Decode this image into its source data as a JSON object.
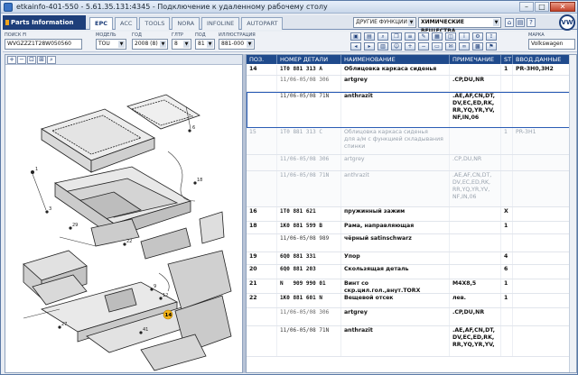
{
  "window": {
    "title": "etkainfo-401-550 - 5.61.35.131:4345 - Подключение к удаленному рабочему столу"
  },
  "topbar": {
    "brand": "Parts Information",
    "tabs": [
      {
        "label": "EPC",
        "active": true
      },
      {
        "label": "ACC",
        "active": false
      },
      {
        "label": "TOOLS",
        "active": false
      },
      {
        "label": "NORA",
        "active": false
      },
      {
        "label": "INFOLINE",
        "active": false
      },
      {
        "label": "AUTOPART",
        "active": false
      }
    ],
    "function_select": "ДРУГИЕ ФУНКЦИИ",
    "group_select": "ХИМИЧЕСКИЕ ВЕЩЕСТВА"
  },
  "filters": {
    "search": {
      "label": "ПОИСК FI",
      "value": "WVGZZZ1T28W050560"
    },
    "model": {
      "label": "МОДЕЛЬ",
      "value": "TOU"
    },
    "year": {
      "label": "ГОД",
      "value": "2008 (8)"
    },
    "gtr": {
      "label": "ГЛТР",
      "value": "8"
    },
    "pod": {
      "label": "ПОД",
      "value": "81"
    },
    "illus": {
      "label": "ИЛЛЮСТРАЦИЯ",
      "value": "881-000"
    },
    "brand": {
      "label": "МАРКА",
      "value": "Volkswagen"
    }
  },
  "table": {
    "headers": [
      "ПОЗ.",
      "НОМЕР ДЕТАЛИ",
      "НАИМЕНОВАНИЕ",
      "ПРИМЕЧАНИЕ",
      "ST",
      "ВВОД.ДАННЫЕ"
    ],
    "rows": [
      {
        "pos": "14",
        "num": "1T0 881 313 A",
        "name": "Облицовка каркаса сиденья",
        "note": "",
        "st": "1",
        "qty": "PR-3H0,3H2",
        "style": "main",
        "h": 12
      },
      {
        "pos": "",
        "num": "11/06-05/08 306",
        "name": "artgrey",
        "note": ".CP,DU,NR",
        "st": "",
        "qty": "",
        "style": "sub",
        "h": 18
      },
      {
        "pos": "",
        "num": "11/06-05/08 71N",
        "name": "anthrazit",
        "note": ".AE,AF,CN,DT,\nDV,EC,ED,RK,\nRR,YQ,YR,YV,\nNF,IN,06",
        "st": "",
        "qty": "",
        "style": "sub dark selected",
        "h": 40
      },
      {
        "pos": "15",
        "num": "1T0 881 313 C",
        "name": "Облицовка каркаса сиденья\nдля а/м с функцией складывания\nспинки",
        "note": "",
        "st": "1",
        "qty": "PR-3H1",
        "style": "grey",
        "h": 30
      },
      {
        "pos": "",
        "num": "11/06-05/08 306",
        "name": "artgrey",
        "note": ".CP,DU,NR",
        "st": "",
        "qty": "",
        "style": "grey",
        "h": 18
      },
      {
        "pos": "",
        "num": "11/06-05/08 71N",
        "name": "anthrazit",
        "note": ".AE,AF,CN,DT,\nDV,EC,ED,RK,\nRR,YQ,YR,YV,\nNF,IN,06",
        "st": "",
        "qty": "",
        "style": "grey",
        "h": 40
      },
      {
        "pos": "16",
        "num": "1T0 881 621",
        "name": "пружинный зажим",
        "note": "",
        "st": "X",
        "qty": "",
        "style": "main",
        "h": 16
      },
      {
        "pos": "18",
        "num": "1K0 881 599 B",
        "name": "Рама, направляющая",
        "note": "",
        "st": "1",
        "qty": "",
        "style": "main",
        "h": 14
      },
      {
        "pos": "",
        "num": "11/06-05/08 989",
        "name": "чёрный satinschwarz",
        "note": "",
        "st": "",
        "qty": "",
        "style": "sub dark",
        "h": 20
      },
      {
        "pos": "19",
        "num": "6Q0 881 331",
        "name": "Упор",
        "note": "",
        "st": "4",
        "qty": "",
        "style": "main",
        "h": 14
      },
      {
        "pos": "20",
        "num": "6Q0 881 203",
        "name": "Скользящая деталь",
        "note": "",
        "st": "6",
        "qty": "",
        "style": "main",
        "h": 16
      },
      {
        "pos": "21",
        "num": "N   909 990 01",
        "name": "Винт со скр.цил.гол.,внут.TORX",
        "note": "M4X8,5",
        "st": "1",
        "qty": "",
        "style": "main",
        "h": 16
      },
      {
        "pos": "22",
        "num": "1K0 881 601 N",
        "name": "Вещевой отсек",
        "note": "лев.",
        "st": "1",
        "qty": "",
        "style": "main",
        "h": 16
      },
      {
        "pos": "",
        "num": "11/06-05/08 306",
        "name": "artgrey",
        "note": ".CP,DU,NR",
        "st": "",
        "qty": "",
        "style": "sub",
        "h": 20
      },
      {
        "pos": "",
        "num": "11/06-05/08 71N",
        "name": "anthrazit",
        "note": ".AE,AF,CN,DT,\nDV,EC,ED,RK,\nRR,YQ,YR,YV,",
        "st": "",
        "qty": "",
        "style": "sub dark",
        "h": 34
      }
    ]
  },
  "illustration": {
    "callout": "14",
    "colors": {
      "accent": "#1f4a8c",
      "callout": "#f3b216"
    }
  }
}
